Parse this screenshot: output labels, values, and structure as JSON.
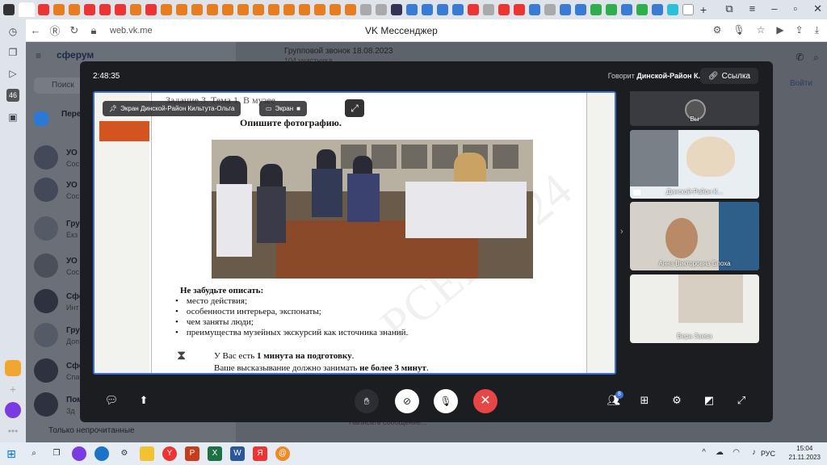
{
  "browser": {
    "url": "web.vk.me",
    "title": "VK Мессенджер"
  },
  "vk": {
    "brand": "сферум",
    "search_placeholder": "Поиск",
    "list": [
      {
        "name": "Пере",
        "sub": ""
      },
      {
        "name": "УО",
        "sub": "Сос"
      },
      {
        "name": "УО",
        "sub": "Сос"
      },
      {
        "name": "Груп",
        "sub": "Екз"
      },
      {
        "name": "УО",
        "sub": "Сос"
      },
      {
        "name": "Сфе",
        "sub": "Инт"
      },
      {
        "name": "Груп",
        "sub": "Доп"
      },
      {
        "name": "Сфе",
        "sub": "Спа"
      },
      {
        "name": "Пом",
        "sub": "Зд"
      }
    ],
    "only_unread": "Только непрочитанные",
    "header_title": "Групповой звонок 18.08.2023",
    "header_sub": "104 участника",
    "join_label": "Войти",
    "message_placeholder": "Написать сообщение..."
  },
  "call": {
    "time": "2:48:35",
    "speaking_label": "Говорит",
    "speaking_name": "Динской-Район К.",
    "link_label": "Ссылка",
    "screen_tag": "Экран Динской-Район Кильтута-Ольга",
    "screen_tag2": "Экран",
    "slide": {
      "title": "Задание 3. Тема 1. В музее",
      "instruction": "Опишите фотографию.",
      "remember": "Не забудьте описать:",
      "bullets": [
        "место действия;",
        "особенности интерьера, экспонаты;",
        "чем заняты люди;",
        "преимущества музейных экскурсий как источника знаний."
      ],
      "minute_line_a": "У Вас есть ",
      "minute_bold": "1 минута на подготовку",
      "minute_line_b": "Ваше высказывание должно занимать ",
      "minute_bold2": "не более 3 минут",
      "watermark": "РСЕК 2024"
    },
    "participants": [
      {
        "name": "Вы"
      },
      {
        "name": "Динской-Район К..."
      },
      {
        "name": "Анна Викторовна Блоха"
      },
      {
        "name": "Вера Заева"
      }
    ],
    "participants_count": "8"
  },
  "taskbar": {
    "lang": "РУС",
    "time": "15:04",
    "date": "21.11.2023"
  },
  "colors": {
    "accent": "#3c6fd4",
    "end_call": "#e64646",
    "modal_bg": "#1c1d20",
    "slide_red": "#d3541f"
  }
}
